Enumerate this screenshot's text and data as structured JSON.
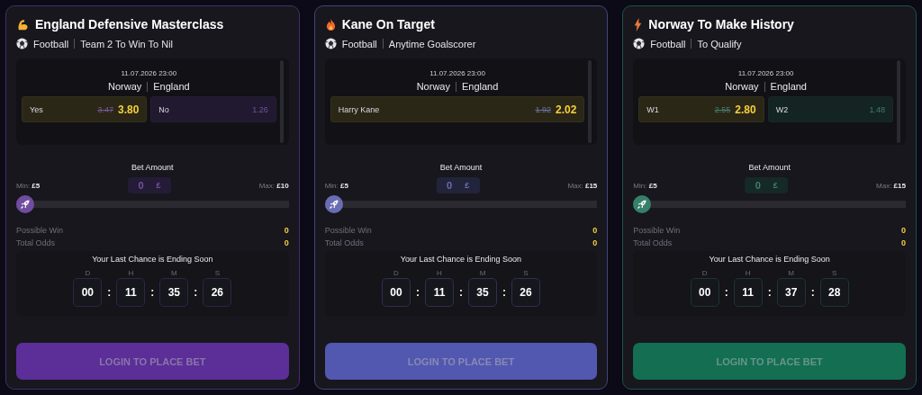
{
  "cards": [
    {
      "kind": "strength",
      "color": "#5b2e98",
      "title": "England Defensive Masterclass",
      "sport": "Football",
      "market": "Team 2 To Win To Nil",
      "date": "11.07.2026 23:00",
      "home": "Norway",
      "away": "England",
      "options": [
        {
          "label": "Yes",
          "old_odds": "3.47",
          "odds": "3.80",
          "selected": true
        },
        {
          "label": "No",
          "odds": "1.26",
          "selected": false
        }
      ],
      "bet_label": "Bet Amount",
      "min_label": "Min:",
      "min": "£5",
      "amount": "0",
      "currency": "£",
      "max_label": "Max:",
      "max": "£10",
      "level": 0,
      "possible_win_label": "Possible Win",
      "possible_win": "0",
      "total_odds_label": "Total Odds",
      "total_odds": "0",
      "countdown_title": "Your Last Chance is Ending Soon",
      "countdown": [
        {
          "unit": "D",
          "value": "00"
        },
        {
          "separator": ":",
          "unit": "H",
          "value": "11"
        },
        {
          "separator": ":",
          "unit": "M",
          "value": "35"
        },
        {
          "separator": ":",
          "unit": "S",
          "value": "26"
        }
      ],
      "button": "LOGIN TO PLACE BET"
    },
    {
      "kind": "fire",
      "color": "#5257b0",
      "title": "Kane On Target",
      "sport": "Football",
      "market": "Anytime Goalscorer",
      "date": "11.07.2026 23:00",
      "home": "Norway",
      "away": "England",
      "options": [
        {
          "label": "Harry Kane",
          "old_odds": "1.92",
          "odds": "2.02",
          "selected": true
        }
      ],
      "bet_label": "Bet Amount",
      "min_label": "Min:",
      "min": "£5",
      "amount": "0",
      "currency": "£",
      "max_label": "Max:",
      "max": "£15",
      "level": 0,
      "possible_win_label": "Possible Win",
      "possible_win": "0",
      "total_odds_label": "Total Odds",
      "total_odds": "0",
      "countdown_title": "Your Last Chance is Ending Soon",
      "countdown": [
        {
          "unit": "D",
          "value": "00"
        },
        {
          "separator": ":",
          "unit": "H",
          "value": "11"
        },
        {
          "separator": ":",
          "unit": "M",
          "value": "35"
        },
        {
          "separator": ":",
          "unit": "S",
          "value": "26"
        }
      ],
      "button": "LOGIN TO PLACE BET"
    },
    {
      "kind": "lightning",
      "color": "#136e52",
      "title": "Norway To Make History",
      "sport": "Football",
      "market": "To Qualify",
      "date": "11.07.2026 23:00",
      "home": "Norway",
      "away": "England",
      "options": [
        {
          "label": "W1",
          "old_odds": "2.55",
          "odds": "2.80",
          "selected": true
        },
        {
          "label": "W2",
          "odds": "1.48",
          "selected": false
        }
      ],
      "bet_label": "Bet Amount",
      "min_label": "Min:",
      "min": "£5",
      "amount": "0",
      "currency": "£",
      "max_label": "Max:",
      "max": "£15",
      "level": 0,
      "possible_win_label": "Possible Win",
      "possible_win": "0",
      "total_odds_label": "Total Odds",
      "total_odds": "0",
      "countdown_title": "Your Last Chance is Ending Soon",
      "countdown": [
        {
          "unit": "D",
          "value": "00"
        },
        {
          "separator": ":",
          "unit": "H",
          "value": "11"
        },
        {
          "separator": ":",
          "unit": "M",
          "value": "37"
        },
        {
          "separator": ":",
          "unit": "S",
          "value": "28"
        }
      ],
      "button": "LOGIN TO PLACE BET"
    }
  ]
}
